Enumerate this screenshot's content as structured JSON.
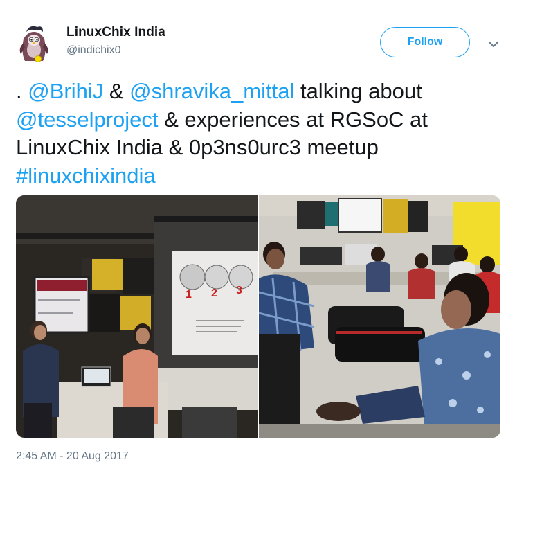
{
  "account": {
    "display_name": "LinuxChix India",
    "handle": "@indichix0",
    "avatar_icon": "penguin-avatar-icon"
  },
  "actions": {
    "follow_label": "Follow",
    "more_icon": "chevron-down-icon"
  },
  "tweet": {
    "segments": [
      {
        "text": ". ",
        "link": false
      },
      {
        "text": "@BrihiJ",
        "link": true
      },
      {
        "text": " & ",
        "link": false
      },
      {
        "text": "@shravika_mittal",
        "link": true
      },
      {
        "text": " talking about ",
        "link": false
      },
      {
        "text": "@tesselproject",
        "link": true
      },
      {
        "text": " & experiences at RGSoC at LinuxChix India & 0p3ns0urc3 meetup ",
        "link": false
      },
      {
        "text": "#linuxchixindia",
        "link": true
      }
    ],
    "timestamp": "2:45 AM - 20 Aug 2017"
  },
  "media": {
    "photos": [
      {
        "description_icon": "presentation-photo",
        "screen_numbers": [
          "1",
          "2",
          "3"
        ]
      },
      {
        "description_icon": "audience-photo"
      }
    ]
  },
  "colors": {
    "link": "#1da1f2",
    "text": "#14171a",
    "secondary": "#657786"
  }
}
